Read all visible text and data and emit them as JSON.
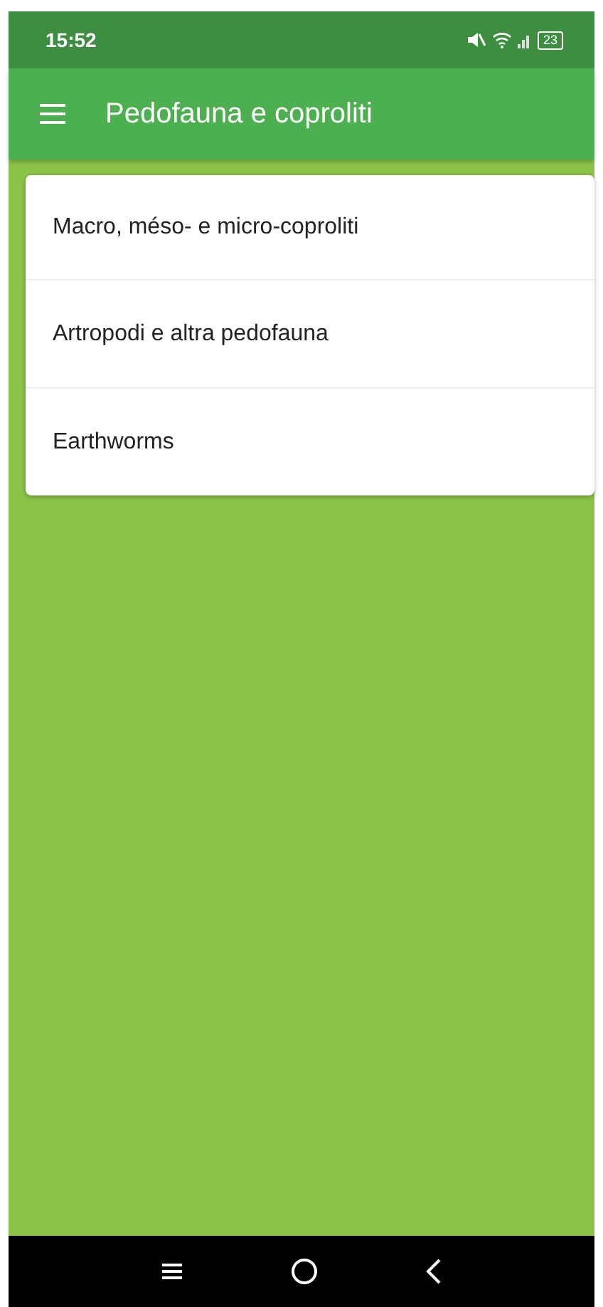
{
  "status_bar": {
    "time": "15:52",
    "battery": "23"
  },
  "app_bar": {
    "title": "Pedofauna e coproliti"
  },
  "items": [
    {
      "label": "Macro, méso- e micro-coproliti"
    },
    {
      "label": "Artropodi e altra pedofauna"
    },
    {
      "label": "Earthworms"
    }
  ]
}
